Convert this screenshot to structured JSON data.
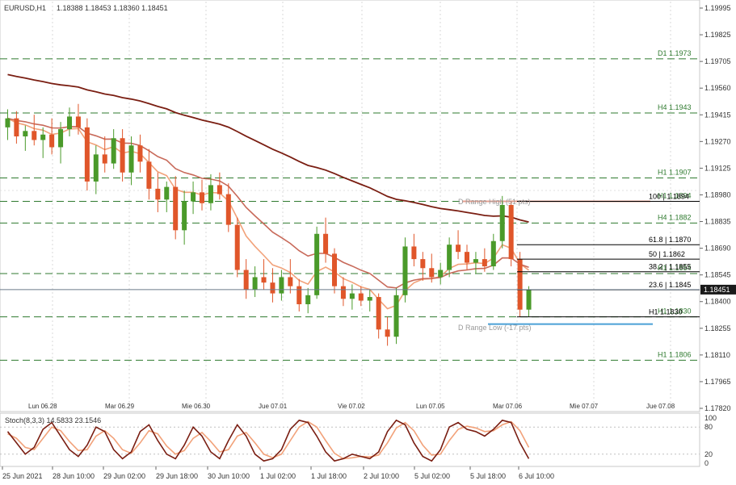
{
  "header": {
    "symbol": "EURUSD,H1",
    "values": "1.18388 1.18453 1.18360 1.18451"
  },
  "colors": {
    "bull": "#4a9a2a",
    "bear": "#e0562a",
    "ma_fast": "#f2a27a",
    "ma_mid": "#c86a5a",
    "ma_slow": "#7a1e12",
    "pivot": "#2f7a2f",
    "fib": "#000000",
    "range_low": "#4aa0d6",
    "stoch_main": "#7a1e12",
    "stoch_signal": "#f2a27a"
  },
  "price_axis": {
    "labels": [
      "1.19995",
      "1.19825",
      "1.19705",
      "1.19560",
      "1.19415",
      "1.19270",
      "1.19125",
      "1.18980",
      "1.18835",
      "1.18690",
      "1.18545",
      "1.18400",
      "1.18255",
      "1.18110",
      "1.17965",
      "1.17820"
    ],
    "current": "1.18451"
  },
  "time_axis": {
    "top_labels": [
      "Lun 06.28",
      "Mar 06.29",
      "Mie 06.30",
      "Jue 07.01",
      "Vie 07.02",
      "Lun 07.05",
      "Mar 07.06",
      "Mie 07.07",
      "Jue 07.08"
    ],
    "bottom_labels": [
      "25 Jun 2021",
      "28 Jun 10:00",
      "29 Jun 02:00",
      "29 Jun 18:00",
      "30 Jun 10:00",
      "1 Jul 02:00",
      "1 Jul 18:00",
      "2 Jul 10:00",
      "5 Jul 02:00",
      "5 Jul 18:00",
      "6 Jul 10:00"
    ]
  },
  "pivot_levels": [
    {
      "label": "D1 1.1973",
      "price": 1.1973
    },
    {
      "label": "H4 1.1943",
      "price": 1.1943
    },
    {
      "label": "H1 1.1907",
      "price": 1.1907
    },
    {
      "label": "H1 1.1894",
      "price": 1.1894
    },
    {
      "label": "H4 1.1882",
      "price": 1.1882
    },
    {
      "label": "H1 1.1854",
      "price": 1.1854
    },
    {
      "label": "H1 1.1830",
      "price": 1.183
    },
    {
      "label": "H1 1.1806",
      "price": 1.1806
    }
  ],
  "fib_levels": [
    {
      "label": "100  | 1.1894",
      "price": 1.1894
    },
    {
      "label": "61.8  | 1.1870",
      "price": 1.187
    },
    {
      "label": "50  | 1.1862",
      "price": 1.1862
    },
    {
      "label": "38.2  | 1.1855",
      "price": 1.1855
    },
    {
      "label": "23.6  | 1.1845",
      "price": 1.1845
    },
    {
      "label": "H1 1.1830",
      "price": 1.183
    }
  ],
  "range_labels": {
    "high": "D Range High (51 pts)",
    "low": "D Range Low (-17 pts)"
  },
  "stoch": {
    "title": "Stoch(8,3,3) 14.5833 23.1546",
    "axis_labels": [
      "100",
      "80",
      "20",
      "0"
    ]
  },
  "chart_data": {
    "type": "candlestick",
    "symbol": "EURUSD",
    "timeframe": "H1",
    "ylim": [
      1.1782,
      1.2002
    ],
    "candles": [
      [
        1.1935,
        1.1945,
        1.1928,
        1.194
      ],
      [
        1.194,
        1.1944,
        1.1926,
        1.193
      ],
      [
        1.193,
        1.1936,
        1.1922,
        1.1933
      ],
      [
        1.1933,
        1.1942,
        1.1925,
        1.1928
      ],
      [
        1.1928,
        1.1935,
        1.1918,
        1.1931
      ],
      [
        1.1931,
        1.194,
        1.192,
        1.1924
      ],
      [
        1.1924,
        1.1938,
        1.1915,
        1.1934
      ],
      [
        1.1934,
        1.1946,
        1.193,
        1.1941
      ],
      [
        1.1941,
        1.1948,
        1.1931,
        1.1935
      ],
      [
        1.1935,
        1.194,
        1.19,
        1.1905
      ],
      [
        1.1905,
        1.1925,
        1.1898,
        1.192
      ],
      [
        1.192,
        1.193,
        1.191,
        1.1915
      ],
      [
        1.1915,
        1.1934,
        1.1912,
        1.1929
      ],
      [
        1.1929,
        1.1934,
        1.1905,
        1.191
      ],
      [
        1.191,
        1.193,
        1.1903,
        1.1925
      ],
      [
        1.1925,
        1.1931,
        1.191,
        1.1916
      ],
      [
        1.1916,
        1.1923,
        1.1895,
        1.1901
      ],
      [
        1.1901,
        1.191,
        1.1888,
        1.1895
      ],
      [
        1.1895,
        1.1905,
        1.1888,
        1.1902
      ],
      [
        1.1902,
        1.1908,
        1.1873,
        1.1878
      ],
      [
        1.1878,
        1.19,
        1.187,
        1.1894
      ],
      [
        1.1894,
        1.1905,
        1.1887,
        1.1899
      ],
      [
        1.1899,
        1.1906,
        1.1889,
        1.1893
      ],
      [
        1.1893,
        1.1909,
        1.1889,
        1.1903
      ],
      [
        1.1903,
        1.191,
        1.1895,
        1.1898
      ],
      [
        1.1898,
        1.1904,
        1.1877,
        1.1881
      ],
      [
        1.1881,
        1.1885,
        1.1852,
        1.1856
      ],
      [
        1.1856,
        1.1862,
        1.184,
        1.1845
      ],
      [
        1.1845,
        1.1858,
        1.1841,
        1.1852
      ],
      [
        1.1852,
        1.1862,
        1.1845,
        1.1849
      ],
      [
        1.1849,
        1.1857,
        1.1838,
        1.1843
      ],
      [
        1.1843,
        1.1856,
        1.1839,
        1.1852
      ],
      [
        1.1852,
        1.1862,
        1.1843,
        1.1847
      ],
      [
        1.1847,
        1.1851,
        1.1833,
        1.1837
      ],
      [
        1.1837,
        1.1846,
        1.1832,
        1.1842
      ],
      [
        1.1842,
        1.188,
        1.184,
        1.1876
      ],
      [
        1.1876,
        1.1885,
        1.186,
        1.1865
      ],
      [
        1.1865,
        1.1868,
        1.1843,
        1.1847
      ],
      [
        1.1847,
        1.1852,
        1.1836,
        1.184
      ],
      [
        1.184,
        1.1848,
        1.1834,
        1.1843
      ],
      [
        1.1843,
        1.1847,
        1.1836,
        1.1839
      ],
      [
        1.1839,
        1.1845,
        1.1833,
        1.1841
      ],
      [
        1.1841,
        1.1843,
        1.1818,
        1.1823
      ],
      [
        1.1823,
        1.183,
        1.1814,
        1.1819
      ],
      [
        1.1819,
        1.1846,
        1.1815,
        1.1842
      ],
      [
        1.1842,
        1.1874,
        1.1838,
        1.1869
      ],
      [
        1.1869,
        1.1876,
        1.1858,
        1.1862
      ],
      [
        1.1862,
        1.1866,
        1.185,
        1.1857
      ],
      [
        1.1857,
        1.1865,
        1.1849,
        1.1852
      ],
      [
        1.1852,
        1.186,
        1.1848,
        1.1856
      ],
      [
        1.1856,
        1.1874,
        1.1852,
        1.187
      ],
      [
        1.187,
        1.1878,
        1.1862,
        1.1866
      ],
      [
        1.1866,
        1.187,
        1.1856,
        1.186
      ],
      [
        1.186,
        1.1866,
        1.1854,
        1.1862
      ],
      [
        1.1862,
        1.1868,
        1.1855,
        1.1858
      ],
      [
        1.1858,
        1.1876,
        1.1856,
        1.1872
      ],
      [
        1.1872,
        1.1897,
        1.1868,
        1.1892
      ],
      [
        1.1892,
        1.1894,
        1.1858,
        1.1862
      ],
      [
        1.1862,
        1.1866,
        1.183,
        1.1834
      ],
      [
        1.1834,
        1.1847,
        1.183,
        1.1845
      ]
    ],
    "stochastic": {
      "main": [
        70,
        45,
        20,
        35,
        75,
        90,
        60,
        30,
        15,
        40,
        80,
        70,
        30,
        10,
        25,
        70,
        85,
        50,
        20,
        10,
        40,
        80,
        60,
        25,
        10,
        50,
        85,
        60,
        20,
        5,
        10,
        30,
        75,
        95,
        90,
        60,
        25,
        5,
        10,
        20,
        15,
        10,
        25,
        70,
        95,
        85,
        45,
        15,
        5,
        30,
        80,
        90,
        75,
        70,
        60,
        75,
        95,
        90,
        45,
        10
      ],
      "signal": [
        65,
        55,
        35,
        30,
        55,
        80,
        72,
        48,
        28,
        30,
        60,
        72,
        55,
        30,
        22,
        45,
        72,
        65,
        38,
        20,
        28,
        55,
        68,
        48,
        25,
        30,
        60,
        68,
        45,
        20,
        12,
        20,
        50,
        80,
        92,
        80,
        50,
        22,
        10,
        12,
        15,
        14,
        18,
        45,
        78,
        90,
        72,
        40,
        18,
        20,
        50,
        75,
        82,
        78,
        70,
        72,
        85,
        92,
        72,
        35
      ],
      "levels": [
        20,
        80
      ],
      "ylim": [
        0,
        100
      ]
    },
    "moving_averages": [
      "fast",
      "mid",
      "slow"
    ]
  }
}
